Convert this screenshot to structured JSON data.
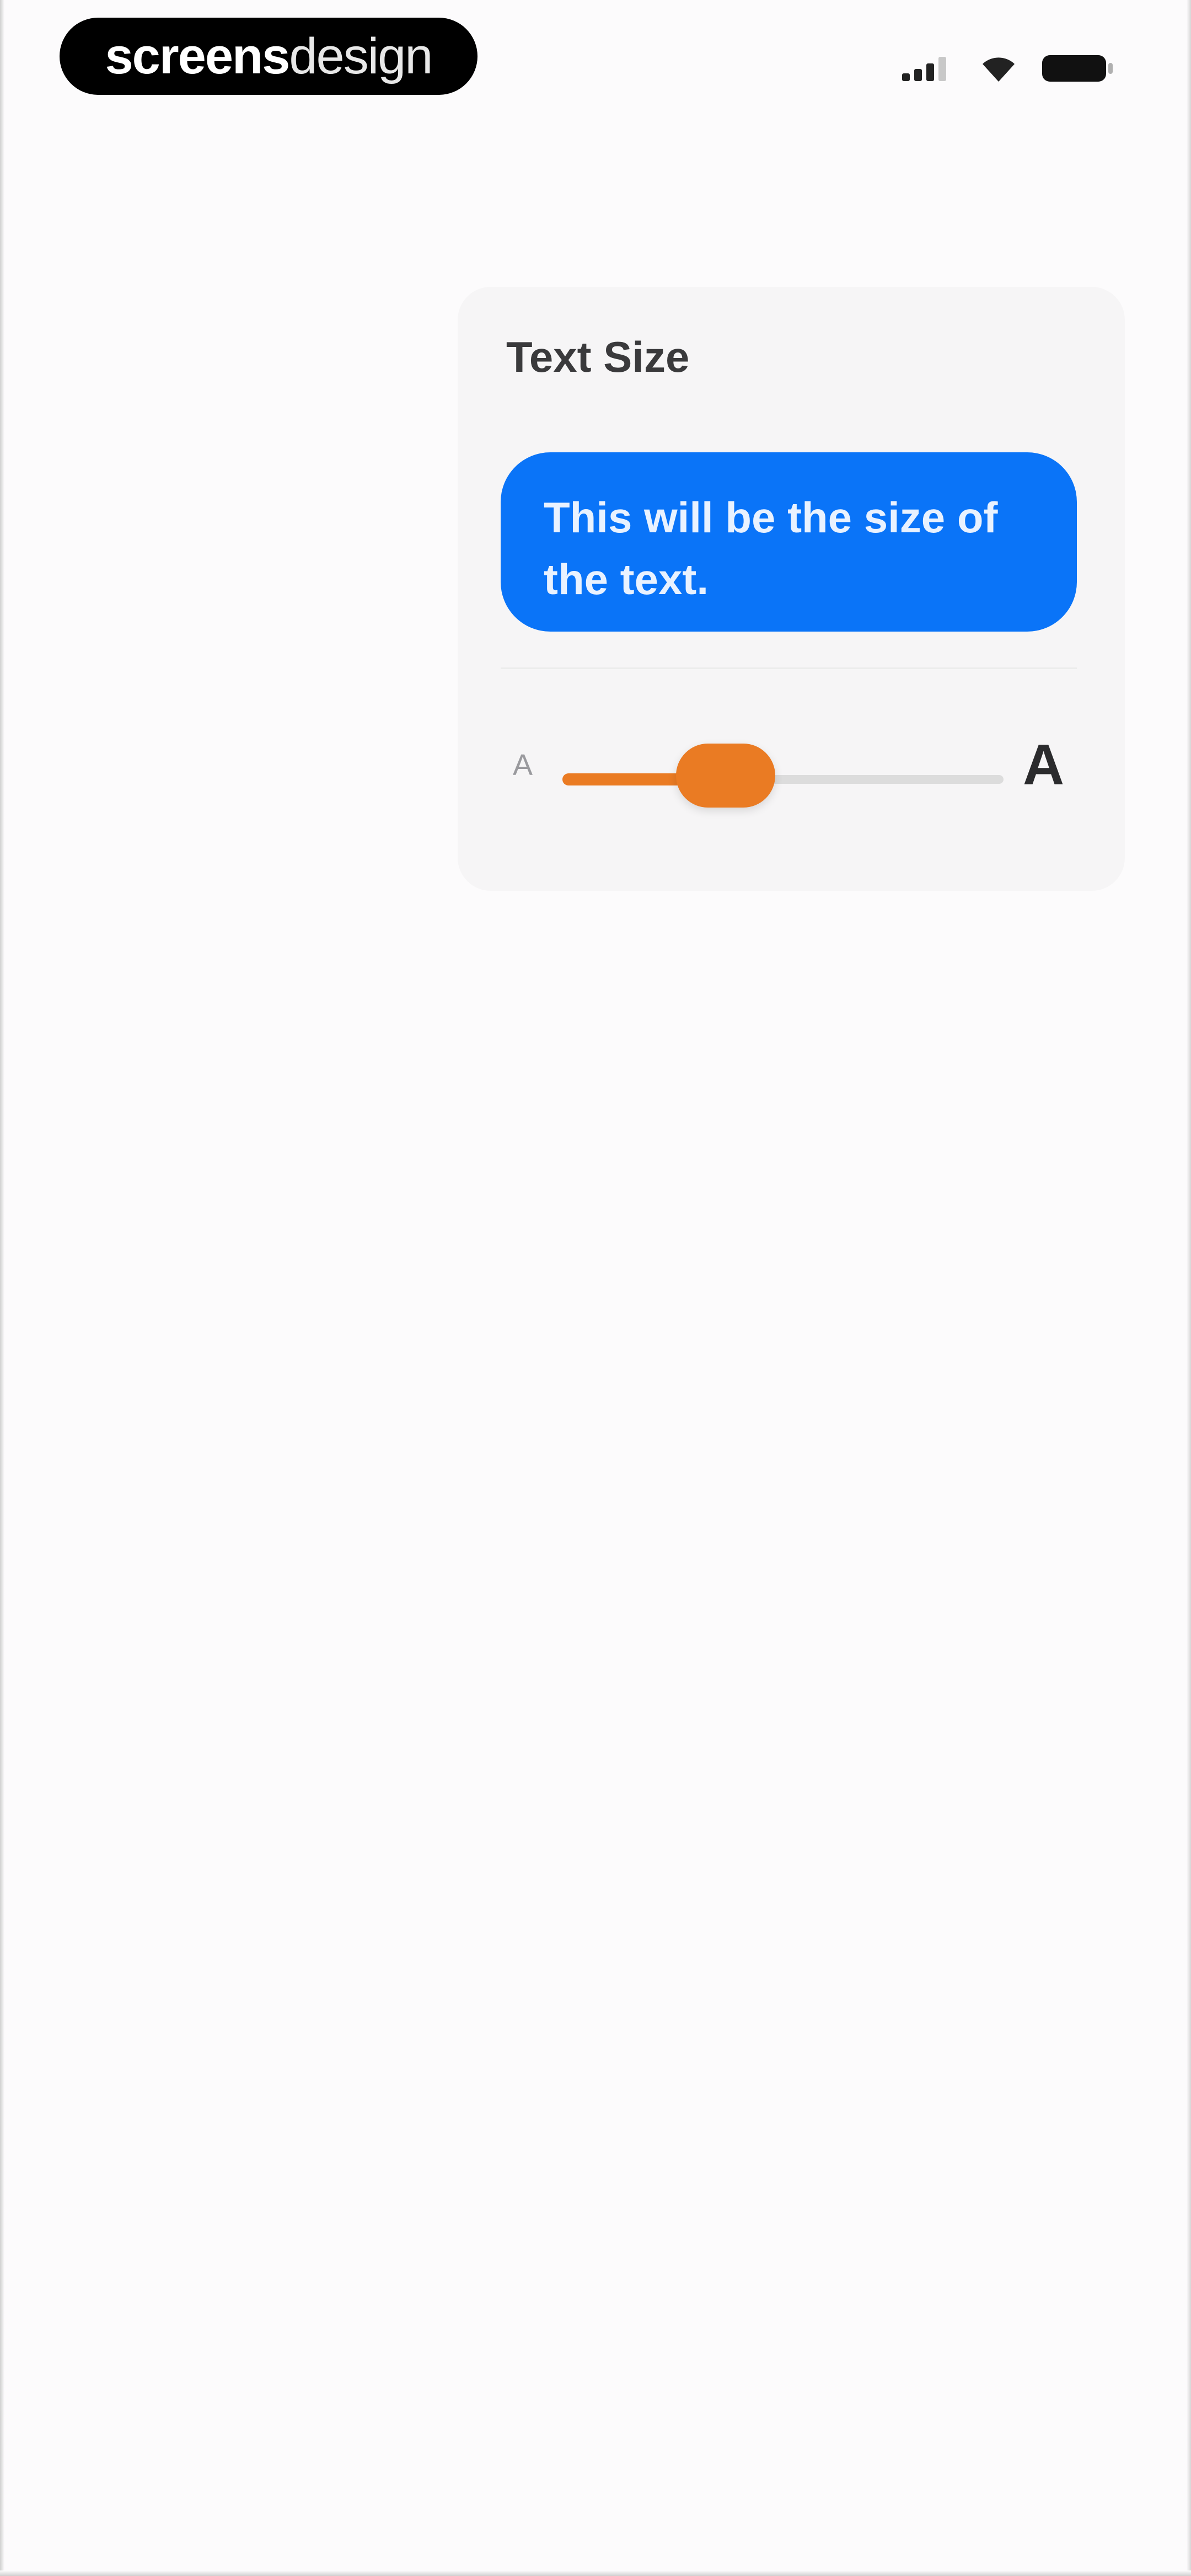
{
  "watermark": {
    "brand_bold": "screens",
    "brand_light": "design"
  },
  "status_bar": {
    "icons": [
      "cellular-signal-icon",
      "wifi-icon",
      "battery-icon"
    ]
  },
  "text_size_card": {
    "title": "Text Size",
    "preview_text": "This will be the size of the text.",
    "slider": {
      "min_label": "A",
      "max_label": "A",
      "value_fraction": 0.37,
      "accent_color": "#EA7B23"
    }
  },
  "colors": {
    "bubble": "#0A74F8",
    "background": "#FCFBFC",
    "card": "#F6F5F6"
  }
}
